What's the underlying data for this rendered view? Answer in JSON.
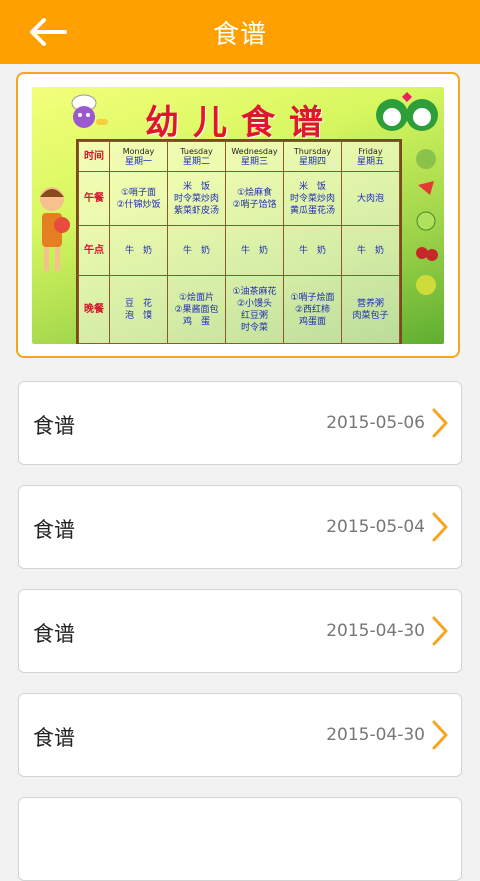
{
  "header": {
    "title": "食谱"
  },
  "banner": {
    "poster_title": "幼儿食谱",
    "days": [
      {
        "en": "Monday",
        "zh": "星期一"
      },
      {
        "en": "Tuesday",
        "zh": "星期二"
      },
      {
        "en": "Wednesday",
        "zh": "星期三"
      },
      {
        "en": "Thursday",
        "zh": "星期四"
      },
      {
        "en": "Friday",
        "zh": "星期五"
      }
    ],
    "corner_label": "时间",
    "rows": [
      {
        "label": "午餐",
        "cells": [
          "①哨子面\n②什锦炒饭",
          "米　饭\n时令菜炒肉\n紫菜虾皮汤",
          "①烩麻食\n②哨子饸饹",
          "米　饭\n时令菜炒肉\n黄瓜蛋花汤",
          "大肉泡"
        ]
      },
      {
        "label": "午点",
        "cells": [
          "牛　奶",
          "牛　奶",
          "牛　奶",
          "牛　奶",
          "牛　奶"
        ]
      },
      {
        "label": "晚餐",
        "cells": [
          "豆　花\n泡　馍",
          "①烩面片\n②果酱面包\n鸡　蛋",
          "①油茶麻花\n②小馒头\n红豆粥\n时令菜",
          "①哨子烩面\n②西红柿\n鸡蛋面",
          "营养粥\n肉菜包子"
        ]
      }
    ]
  },
  "list": {
    "items": [
      {
        "title": "食谱",
        "date": "2015-05-06"
      },
      {
        "title": "食谱",
        "date": "2015-05-04"
      },
      {
        "title": "食谱",
        "date": "2015-04-30"
      },
      {
        "title": "食谱",
        "date": "2015-04-30"
      }
    ]
  },
  "colors": {
    "accent": "#ffa000",
    "chevron": "#f7a41f",
    "banner_border": "#f7a41f"
  }
}
